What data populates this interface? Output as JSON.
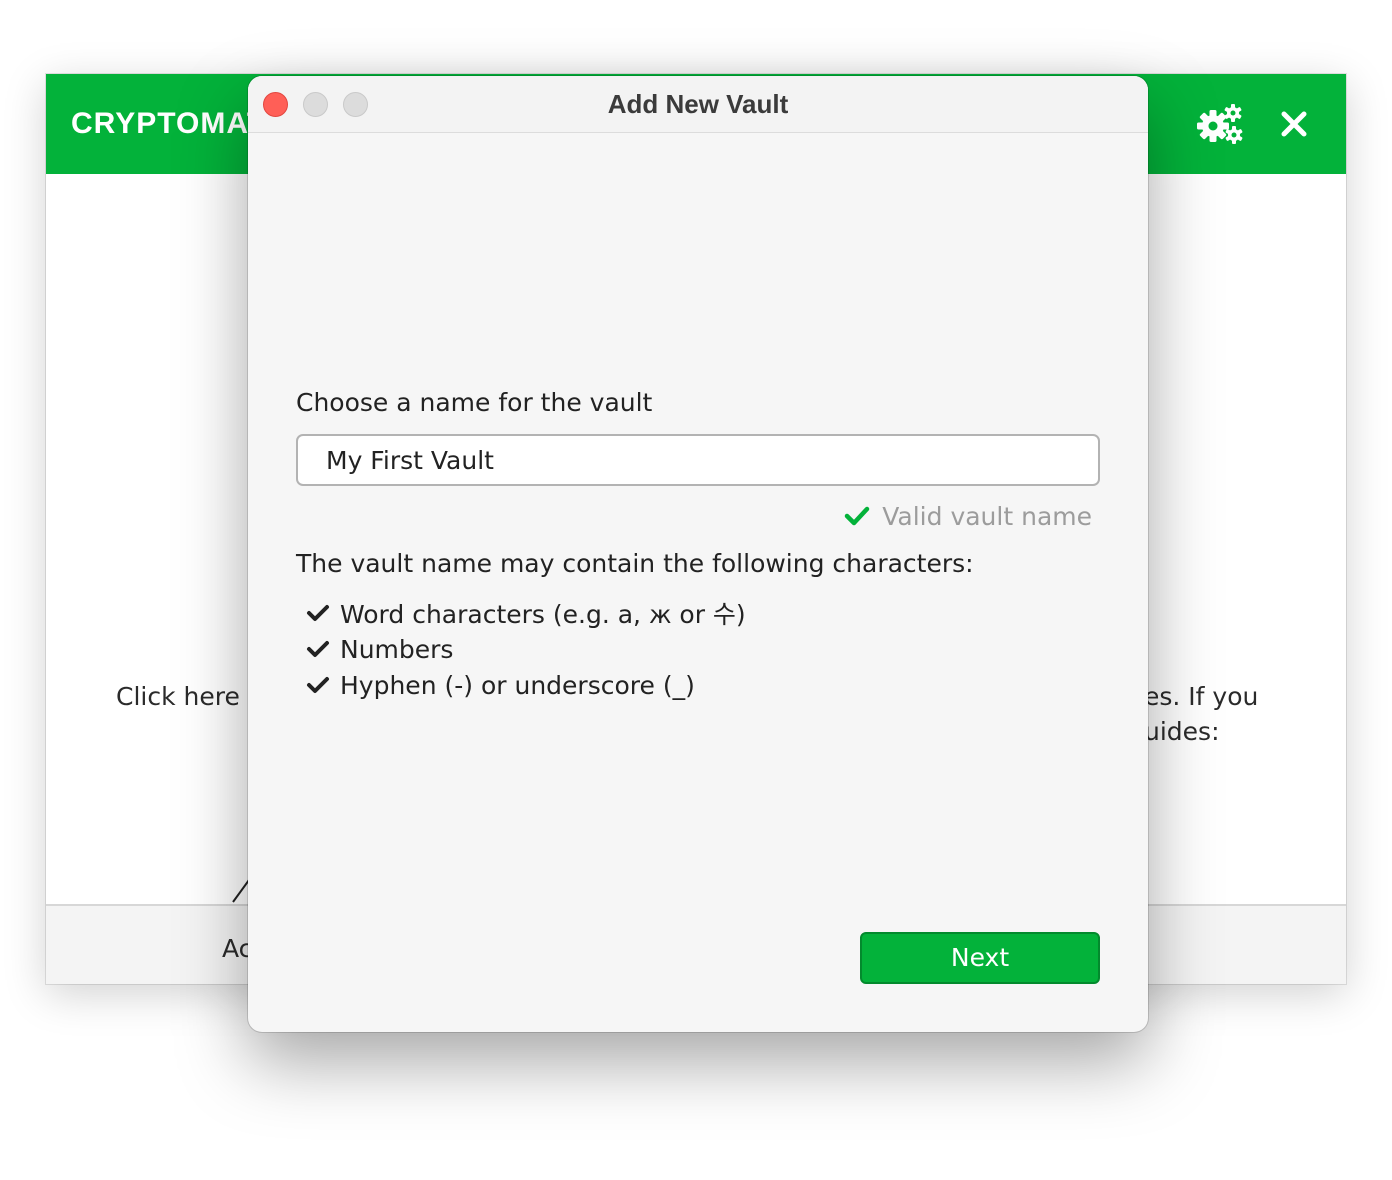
{
  "main_window": {
    "brand": "CRYPTOMAT",
    "settings_icon": "gears-icon",
    "close_icon": "close-icon",
    "welcome_left": "Click here t",
    "welcome_right_line1": "es. If you",
    "welcome_right_line2": "uides:",
    "footer_button_partial": "Ac",
    "accent_color": "#03b23a"
  },
  "dialog": {
    "title": "Add New Vault",
    "window_controls": [
      "close",
      "minimize",
      "maximize"
    ],
    "name_label": "Choose a name for the vault",
    "name_input_value": "My First Vault",
    "validation": {
      "icon": "check-icon",
      "text": "Valid vault name",
      "color": "#03b23a"
    },
    "rules_heading": "The vault name may contain the following characters:",
    "rules": [
      "Word characters (e.g. a, ж or 수)",
      "Numbers",
      "Hyphen (-) or underscore (_)"
    ],
    "next_label": "Next"
  }
}
